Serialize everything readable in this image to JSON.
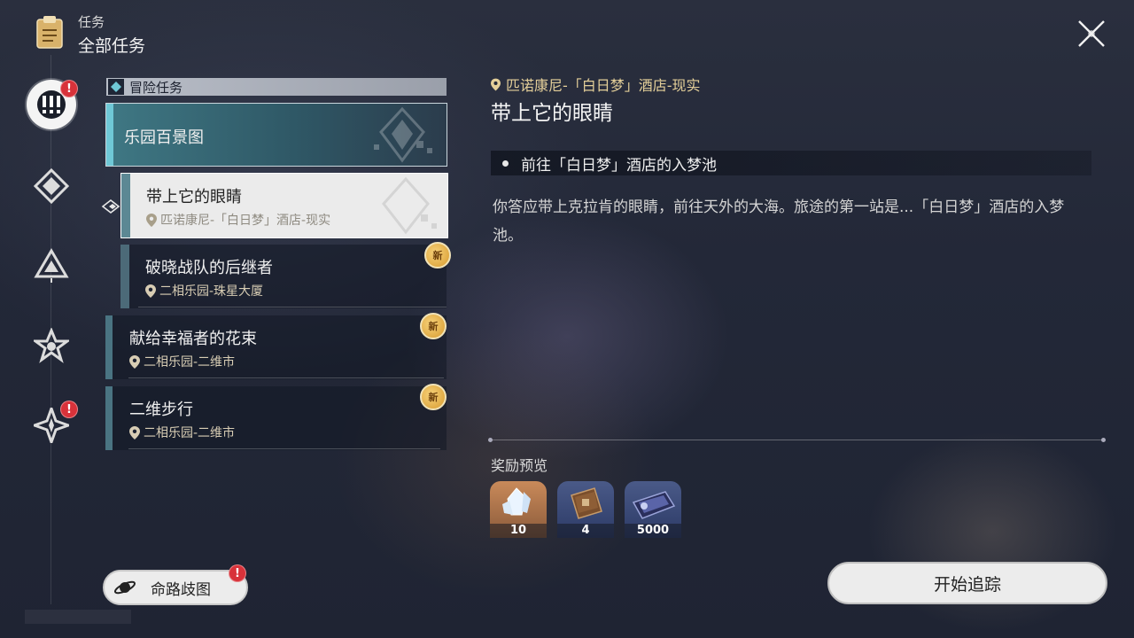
{
  "header": {
    "small_title": "任务",
    "big_title": "全部任务"
  },
  "sidebar": {
    "items": [
      {
        "name": "adventure",
        "icon": "exclamation-icon",
        "active": true,
        "badge": "!"
      },
      {
        "name": "category-2",
        "icon": "diamond-star-icon",
        "active": false
      },
      {
        "name": "category-3",
        "icon": "triangle-icon",
        "active": false
      },
      {
        "name": "category-4",
        "icon": "star-icon",
        "active": false
      },
      {
        "name": "category-5",
        "icon": "compass-star-icon",
        "active": false,
        "badge": "!"
      }
    ]
  },
  "category": {
    "label": "冒险任务"
  },
  "quest_group": {
    "title": "乐园百景图"
  },
  "quests": [
    {
      "title": "带上它的眼睛",
      "location": "匹诺康尼-「白日梦」酒店-现实",
      "selected": true,
      "is_new": false
    },
    {
      "title": "破晓战队的后继者",
      "location": "二相乐园-珠星大厦",
      "selected": false,
      "is_new": true
    },
    {
      "title": "献给幸福者的花束",
      "location": "二相乐园-二维市",
      "selected": false,
      "is_new": true
    },
    {
      "title": "二维步行",
      "location": "二相乐园-二维市",
      "selected": false,
      "is_new": true
    }
  ],
  "new_badge_label": "新",
  "detail": {
    "location": "匹诺康尼-「白日梦」酒店-现实",
    "title": "带上它的眼睛",
    "objective": "前往「白日梦」酒店的入梦池",
    "description": "你答应带上克拉肯的眼睛，前往天外的大海。旅途的第一站是...「白日梦」酒店的入梦池。",
    "reward_label": "奖励预览",
    "rewards": [
      {
        "name": "crystal-reward",
        "qty": "10",
        "color": "#c98a5a"
      },
      {
        "name": "book-reward",
        "qty": "4",
        "color": "#4a5a88"
      },
      {
        "name": "credit-reward",
        "qty": "5000",
        "color": "#4a5a88"
      }
    ]
  },
  "buttons": {
    "start_tracking": "开始追踪",
    "fate_map": "命路歧图",
    "fate_badge": "!"
  },
  "colors": {
    "accent_teal": "#6fc8d6",
    "location_gold": "#e4cf99",
    "alert_red": "#d8323a"
  }
}
